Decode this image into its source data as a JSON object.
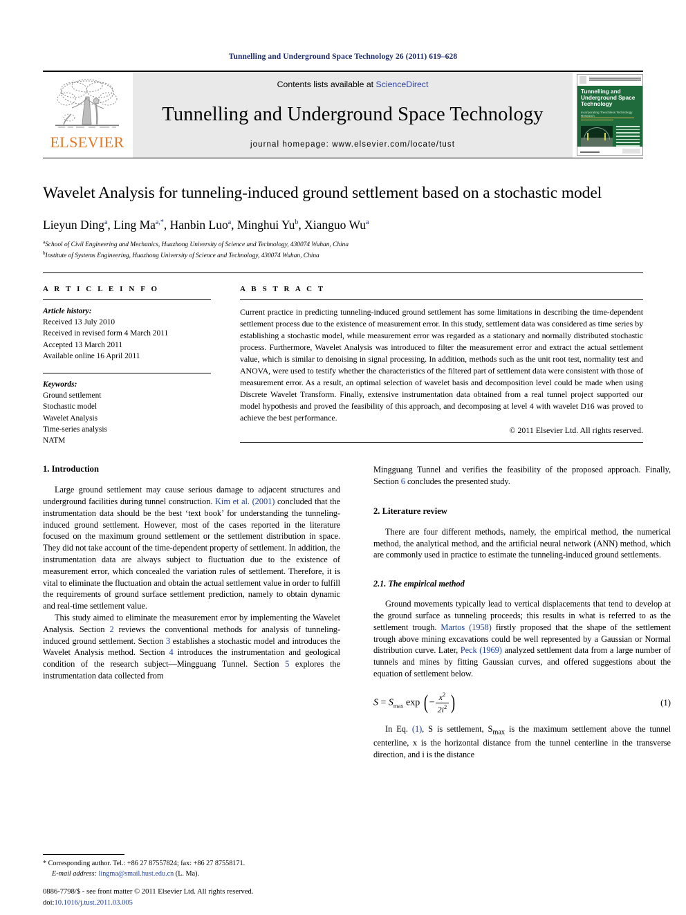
{
  "running_head": "Tunnelling and Underground Space Technology 26 (2011) 619–628",
  "masthead": {
    "publisher": "ELSEVIER",
    "contents_prefix": "Contents lists available at ",
    "contents_link": "ScienceDirect",
    "journal_title": "Tunnelling and Underground Space Technology",
    "homepage": "journal homepage: www.elsevier.com/locate/tust",
    "cover": {
      "title": "Tunnelling and Underground Space Technology",
      "subtitle": "incorporating Trenchless Technology Research",
      "footer_url": "www.elsevier.com"
    }
  },
  "article": {
    "title": "Wavelet Analysis for tunneling-induced ground settlement based on a stochastic model",
    "authors": "Lieyun Ding a, Ling Ma a,*, Hanbin Luo a, Minghui Yu b, Xianguo Wu a",
    "author_list": [
      {
        "name": "Lieyun Ding",
        "sup": "a"
      },
      {
        "name": "Ling Ma",
        "sup": "a,*"
      },
      {
        "name": "Hanbin Luo",
        "sup": "a"
      },
      {
        "name": "Minghui Yu",
        "sup": "b"
      },
      {
        "name": "Xianguo Wu",
        "sup": "a"
      }
    ],
    "affiliations": [
      {
        "mark": "a",
        "text": "School of Civil Engineering and Mechanics, Huazhong University of Science and Technology, 430074 Wuhan, China"
      },
      {
        "mark": "b",
        "text": "Institute of Systems Engineering, Huazhong University of Science and Technology, 430074 Wuhan, China"
      }
    ]
  },
  "info": {
    "heading": "A R T I C L E   I N F O",
    "history_label": "Article history:",
    "history": [
      "Received 13 July 2010",
      "Received in revised form 4 March 2011",
      "Accepted 13 March 2011",
      "Available online 16 April 2011"
    ],
    "keywords_label": "Keywords:",
    "keywords": [
      "Ground settlement",
      "Stochastic model",
      "Wavelet Analysis",
      "Time-series analysis",
      "NATM"
    ]
  },
  "abstract": {
    "heading": "A B S T R A C T",
    "text": "Current practice in predicting tunneling-induced ground settlement has some limitations in describing the time-dependent settlement process due to the existence of measurement error. In this study, settlement data was considered as time series by establishing a stochastic model, while measurement error was regarded as a stationary and normally distributed stochastic process. Furthermore, Wavelet Analysis was introduced to filter the measurement error and extract the actual settlement value, which is similar to denoising in signal processing. In addition, methods such as the unit root test, normality test and ANOVA, were used to testify whether the characteristics of the filtered part of settlement data were consistent with those of measurement error. As a result, an optimal selection of wavelet basis and decomposition level could be made when using Discrete Wavelet Transform. Finally, extensive instrumentation data obtained from a real tunnel project supported our model hypothesis and proved the feasibility of this approach, and decomposing at level 4 with wavelet D16 was proved to achieve the best performance.",
    "copyright": "© 2011 Elsevier Ltd. All rights reserved."
  },
  "body": {
    "sec1_heading": "1. Introduction",
    "sec1_p1_a": "Large ground settlement may cause serious damage to adjacent structures and underground facilities during tunnel construction. ",
    "sec1_p1_ref": "Kim et al. (2001)",
    "sec1_p1_b": " concluded that the instrumentation data should be the best ‘text book’ for understanding the tunneling-induced ground settlement. However, most of the cases reported in the literature focused on the maximum ground settlement or the settlement distribution in space. They did not take account of the time-dependent property of settlement. In addition, the instrumentation data are always subject to fluctuation due to the existence of measurement error, which concealed the variation rules of settlement. Therefore, it is vital to eliminate the fluctuation and obtain the actual settlement value in order to fulfill the requirements of ground surface settlement prediction, namely to obtain dynamic and real-time settlement value.",
    "sec1_p2_a": "This study aimed to eliminate the measurement error by implementing the Wavelet Analysis. Section ",
    "sec1_p2_r2": "2",
    "sec1_p2_b": " reviews the conventional methods for analysis of tunneling-induced ground settlement. Section ",
    "sec1_p2_r3": "3",
    "sec1_p2_c": " establishes a stochastic model and introduces the Wavelet Analysis method. Section ",
    "sec1_p2_r4": "4",
    "sec1_p2_d": " introduces the instrumentation and geological condition of the research subject—Mingguang Tunnel. Section ",
    "sec1_p2_r5": "5",
    "sec1_p2_e": " explores the instrumentation data collected from ",
    "sec1_p2_f": "Mingguang Tunnel and verifies the feasibility of the proposed approach. Finally, Section ",
    "sec1_p2_r6": "6",
    "sec1_p2_g": " concludes the presented study.",
    "sec2_heading": "2. Literature review",
    "sec2_p1": "There are four different methods, namely, the empirical method, the numerical method, the analytical method, and the artificial neural network (ANN) method, which are commonly used in practice to estimate the tunneling-induced ground settlements.",
    "sec21_heading": "2.1. The empirical method",
    "sec21_p1_a": "Ground movements typically lead to vertical displacements that tend to develop at the ground surface as tunneling proceeds; this results in what is referred to as the settlement trough. ",
    "sec21_ref1": "Martos (1958)",
    "sec21_p1_b": " firstly proposed that the shape of the settlement trough above mining excavations could be well represented by a Gaussian or Normal distribution curve. Later, ",
    "sec21_ref2": "Peck (1969)",
    "sec21_p1_c": " analyzed settlement data from a large number of tunnels and mines by fitting Gaussian curves, and offered suggestions about the equation of settlement below.",
    "equation": {
      "lhs": "S",
      "eq": "=",
      "smax": "S",
      "smax_sub": "max",
      "exp": "exp",
      "minus": "−",
      "num": "x",
      "num_sup": "2",
      "den": "2i",
      "den_sup": "2",
      "number": "(1)"
    },
    "eq_p_a": "In Eq. ",
    "eq_p_ref": "(1)",
    "eq_p_b": ", S is settlement, S",
    "eq_p_sub": "max",
    "eq_p_c": " is the maximum settlement above the tunnel centerline, x is the horizontal distance from the tunnel centerline in the transverse direction, and i is the distance"
  },
  "footnotes": {
    "corresponding": "* Corresponding author. Tel.: +86 27 87557824; fax: +86 27 87558171.",
    "email_label": "E-mail address:",
    "email": "lingma@smail.hust.edu.cn",
    "email_suffix": " (L. Ma).",
    "imprint": "0886-7798/$ - see front matter © 2011 Elsevier Ltd. All rights reserved.",
    "doi_label": "doi:",
    "doi": "10.1016/j.tust.2011.03.005"
  },
  "colors": {
    "link": "#1a3fa0",
    "running_head": "#1a2a6c",
    "elsevier_orange": "#E87722",
    "masthead_bg": "#e9e9e9",
    "cover_green": "#1f6b3b"
  }
}
